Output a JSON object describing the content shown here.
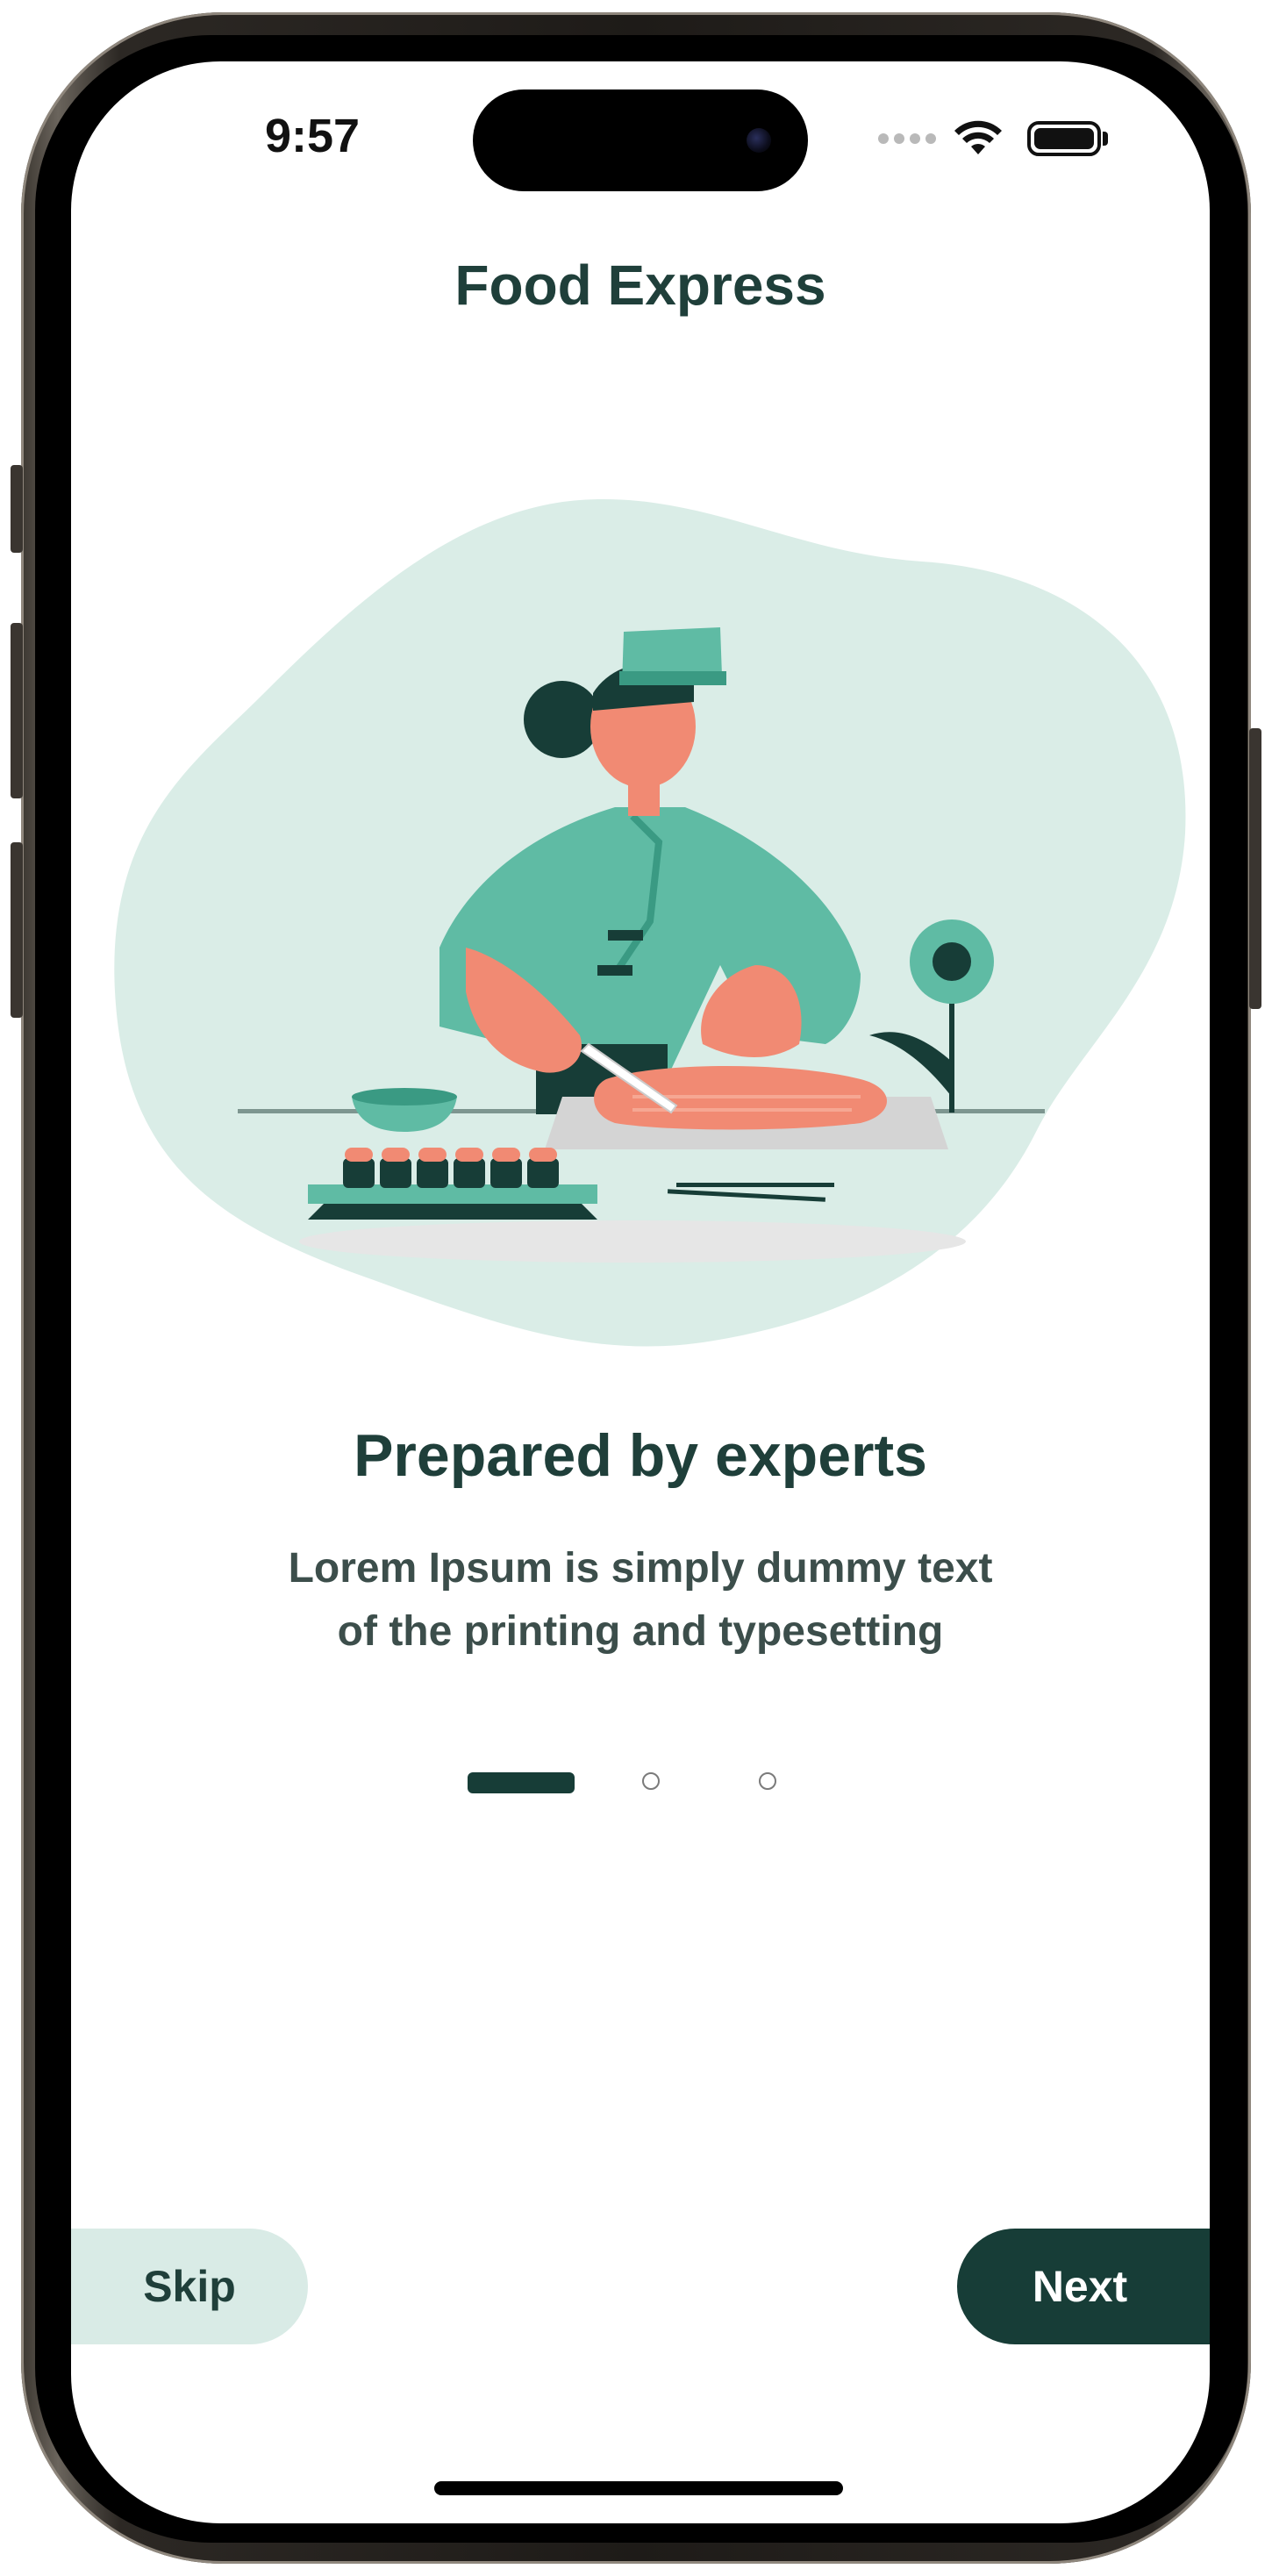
{
  "status_bar": {
    "time": "9:57",
    "icons": [
      "signal-dots-icon",
      "wifi-icon",
      "battery-icon"
    ]
  },
  "app": {
    "title": "Food Express"
  },
  "onboarding": {
    "illustration": "chef-slicing-salmon-illustration",
    "heading": "Prepared by experts",
    "subtext_line1": "Lorem Ipsum is simply dummy text",
    "subtext_line2": "of the printing and typesetting",
    "page_indicator": {
      "current": 1,
      "total": 3
    }
  },
  "actions": {
    "skip_label": "Skip",
    "next_label": "Next"
  },
  "colors": {
    "primary": "#173d37",
    "text": "#1f3f3a",
    "skip_bg": "#d9ebe6",
    "illustration_blob": "#daede7",
    "chef_uniform": "#5fbba4",
    "salmon": "#f18a73"
  }
}
